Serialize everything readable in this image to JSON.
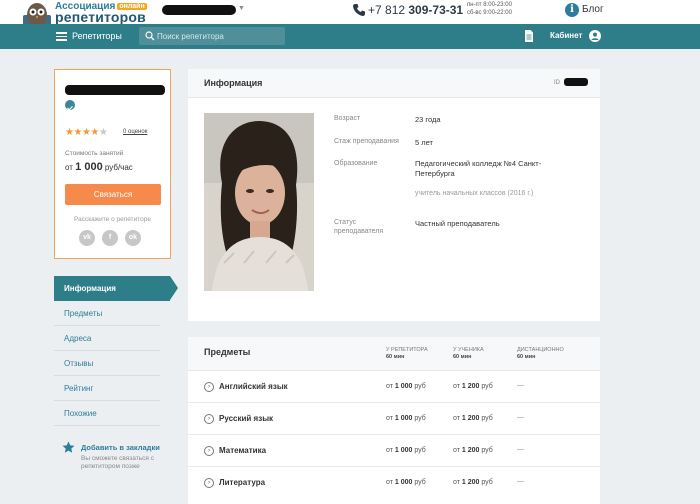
{
  "header": {
    "logo_line1": "Ассоциация",
    "logo_online": "онлайн",
    "logo_line2": "репетиторов",
    "phone_prefix": "+7 812 ",
    "phone_main": "309-73-31",
    "hours_weekday": "пн-пт 8:00-23:00",
    "hours_weekend": "сб-вс 9:00-22:00",
    "blog_label": "Блог"
  },
  "nav": {
    "tutors_label": "Репетиторы",
    "search_placeholder": "Поиск репетитора",
    "cabinet_label": "Кабинет"
  },
  "profile_card": {
    "rating_stars": 4,
    "rating_max": 5,
    "reviews_link": "0 оценок",
    "cost_label": "Стоимость занятий",
    "cost_prefix": "от ",
    "cost_amount": "1 000",
    "cost_unit": " руб/час",
    "contact_button": "Связаться",
    "share_label": "Расскажите о репетиторе",
    "social": [
      "vk",
      "f",
      "ok"
    ]
  },
  "side_menu": {
    "items": [
      "Информация",
      "Предметы",
      "Адреса",
      "Отзывы",
      "Рейтинг",
      "Похожие"
    ],
    "active_index": 0
  },
  "bookmark": {
    "title": "Добавить в закладки",
    "note": "Вы сможете связаться с репетитором позже"
  },
  "info": {
    "title": "Информация",
    "id_label": "ID",
    "fields": {
      "age_label": "Возраст",
      "age_value": "23 года",
      "experience_label": "Стаж преподавания",
      "experience_value": "5 лет",
      "education_label": "Образование",
      "education_value": "Педагогический колледж №4 Санкт-Петербурга",
      "education_sub": "учитель начальных классов (2016 г.)",
      "status_label": "Статус преподавателя",
      "status_value": "Частный преподаватель"
    }
  },
  "subjects": {
    "title": "Предметы",
    "columns": [
      {
        "label": "У РЕПЕТИТОРА",
        "sub": "60 мин"
      },
      {
        "label": "У УЧЕНИКА",
        "sub": "60 мин"
      },
      {
        "label": "ДИСТАНЦИОННО",
        "sub": "60 мин"
      }
    ],
    "price_prefix": "от ",
    "price_unit": " руб",
    "rows": [
      {
        "name": "Английский язык",
        "tutor": "1 000",
        "student": "1 200",
        "remote": "—"
      },
      {
        "name": "Русский язык",
        "tutor": "1 000",
        "student": "1 200",
        "remote": "—"
      },
      {
        "name": "Математика",
        "tutor": "1 000",
        "student": "1 200",
        "remote": "—"
      },
      {
        "name": "Литература",
        "tutor": "1 000",
        "student": "1 200",
        "remote": "—"
      }
    ]
  },
  "colors": {
    "teal": "#2e7e8a",
    "orange": "#f58a4b",
    "star": "#f29a3a",
    "background": "#eceff1"
  }
}
